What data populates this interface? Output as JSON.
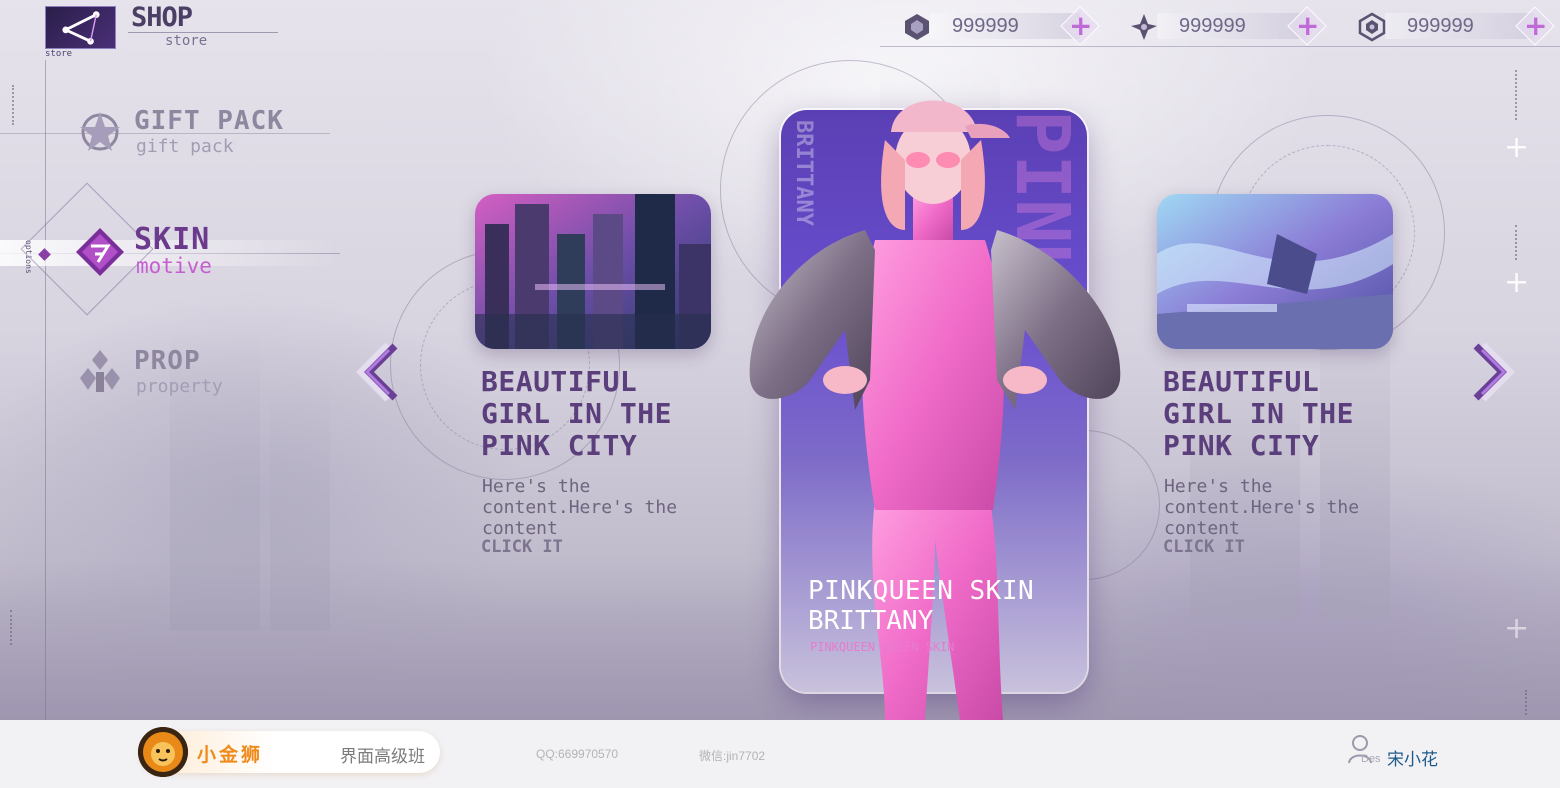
{
  "header": {
    "logo_caption": "store",
    "title": "SHOP",
    "subtitle": "store"
  },
  "currencies": [
    {
      "icon": "hexagon-gem-icon",
      "value": "999999"
    },
    {
      "icon": "triangle-crystal-icon",
      "value": "999999"
    },
    {
      "icon": "hex-coin-icon",
      "value": "999999"
    }
  ],
  "nav": {
    "side_label": "options",
    "items": [
      {
        "label": "GIFT PACK",
        "sub": "gift pack",
        "icon": "star-badge-icon",
        "active": false
      },
      {
        "label": "SKIN",
        "sub": "motive",
        "icon": "skin-emblem-icon",
        "active": true
      },
      {
        "label": "PROP",
        "sub": "property",
        "icon": "prop-emblem-icon",
        "active": false
      }
    ]
  },
  "cards": [
    {
      "title": "BEAUTIFUL GIRL IN THE PINK CITY",
      "desc": "Here's the content.Here's the content",
      "cta": "CLICK IT"
    },
    {
      "title": "BEAUTIFUL GIRL IN THE PINK CITY",
      "desc": "Here's the content.Here's the content",
      "cta": "CLICK IT"
    }
  ],
  "featured": {
    "name_line1": "PINKQUEEN SKIN",
    "name_line2": "BRITTANY",
    "tag": "PINKQUEEN QUEEN SKIN",
    "vertical_text": "BRITTANY",
    "big_letters": "PINK"
  },
  "colors": {
    "accent_purple": "#6c3a8c",
    "accent_pink": "#c65ed0",
    "feature_top": "#5a3fb4",
    "brand_orange": "#f08a1a"
  },
  "footer": {
    "brand_name": "小金狮",
    "course": "界面高级班",
    "qq": "QQ:669970570",
    "wechat": "微信:jin7702",
    "des_label": "Des",
    "author": "宋小花"
  }
}
